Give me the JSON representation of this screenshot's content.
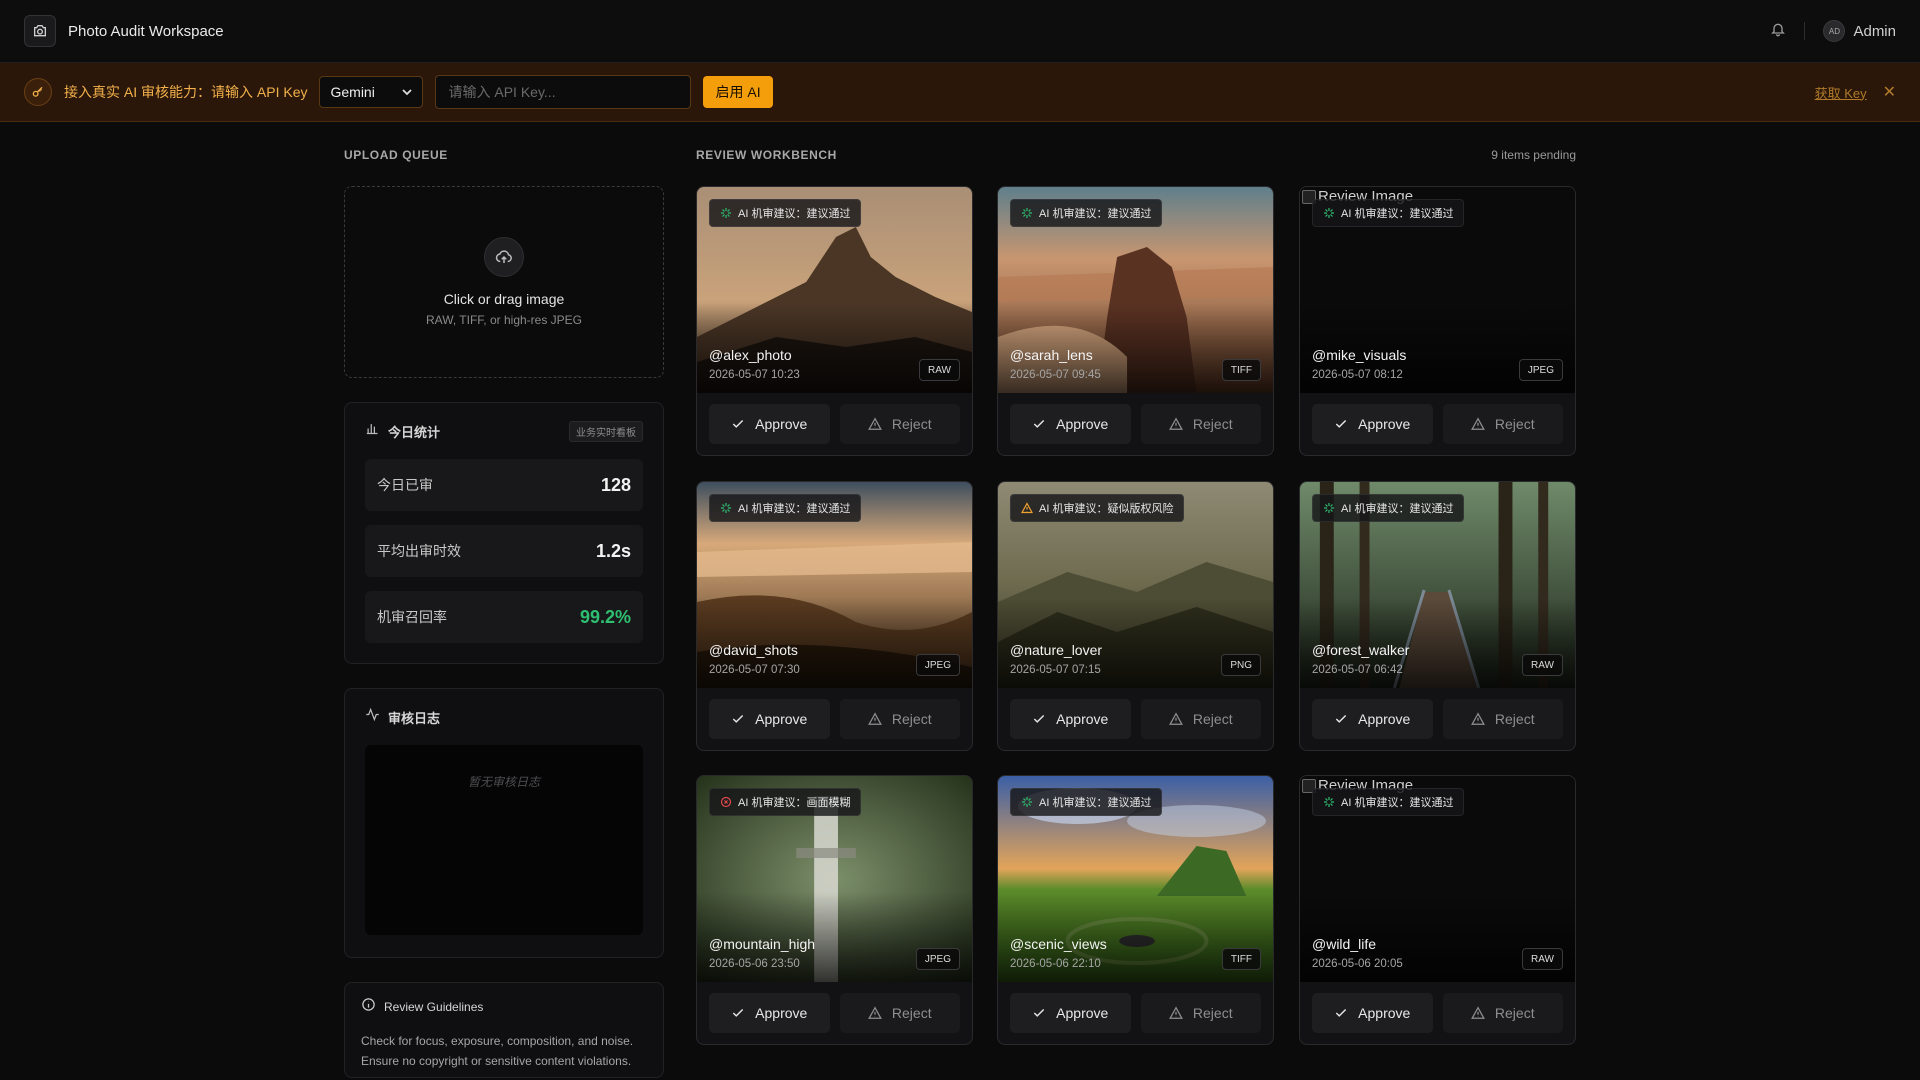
{
  "header": {
    "title": "Photo Audit Workspace",
    "user": "Admin",
    "avatar_initials": "AD"
  },
  "banner": {
    "text": "接入真实 AI 审核能力：请输入 API Key",
    "provider": "Gemini",
    "api_placeholder": "请输入 API Key...",
    "enable_label": "启用 AI",
    "get_key_label": "获取 Key"
  },
  "left": {
    "upload_label": "UPLOAD QUEUE",
    "upload_title": "Click or drag image",
    "upload_sub": "RAW, TIFF, or high-res JPEG",
    "stats_title": "今日统计",
    "stats_tag": "业务实时看板",
    "stats": [
      {
        "label": "今日已审",
        "value": "128"
      },
      {
        "label": "平均出审时效",
        "value": "1.2s"
      },
      {
        "label": "机审召回率",
        "value": "99.2%"
      }
    ],
    "log_title": "审核日志",
    "log_empty": "暂无审核日志",
    "guide_title": "Review Guidelines",
    "guide_text": "Check for focus, exposure, composition, and noise. Ensure no copyright or sensitive content violations."
  },
  "workbench": {
    "label": "REVIEW WORKBENCH",
    "pending": "9 items pending",
    "approve_label": "Approve",
    "reject_label": "Reject",
    "broken_alt": "Review Image",
    "items": [
      {
        "user": "@alex_photo",
        "time": "2026-05-07 10:23",
        "format": "RAW",
        "ai": "AI 机审建议：建议通过",
        "status": "pass",
        "scene": "mountain"
      },
      {
        "user": "@sarah_lens",
        "time": "2026-05-07 09:45",
        "format": "TIFF",
        "ai": "AI 机审建议：建议通过",
        "status": "pass",
        "scene": "desert"
      },
      {
        "user": "@mike_visuals",
        "time": "2026-05-07 08:12",
        "format": "JPEG",
        "ai": "AI 机审建议：建议通过",
        "status": "pass",
        "scene": "broken"
      },
      {
        "user": "@david_shots",
        "time": "2026-05-07 07:30",
        "format": "JPEG",
        "ai": "AI 机审建议：建议通过",
        "status": "pass",
        "scene": "coast"
      },
      {
        "user": "@nature_lover",
        "time": "2026-05-07 07:15",
        "format": "PNG",
        "ai": "AI 机审建议：疑似版权风险",
        "status": "warn",
        "scene": "valley"
      },
      {
        "user": "@forest_walker",
        "time": "2026-05-07 06:42",
        "format": "RAW",
        "ai": "AI 机审建议：建议通过",
        "status": "pass",
        "scene": "forest"
      },
      {
        "user": "@mountain_high",
        "time": "2026-05-06 23:50",
        "format": "JPEG",
        "ai": "AI 机审建议：画面模糊",
        "status": "fail",
        "scene": "waterfall"
      },
      {
        "user": "@scenic_views",
        "time": "2026-05-06 22:10",
        "format": "TIFF",
        "ai": "AI 机审建议：建议通过",
        "status": "pass",
        "scene": "meadow"
      },
      {
        "user": "@wild_life",
        "time": "2026-05-06 20:05",
        "format": "RAW",
        "ai": "AI 机审建议：建议通过",
        "status": "pass",
        "scene": "broken"
      }
    ]
  },
  "colors": {
    "accent": "#f59e0b",
    "pass": "#2fbf71",
    "warn": "#f0a030",
    "fail": "#e5484d"
  }
}
